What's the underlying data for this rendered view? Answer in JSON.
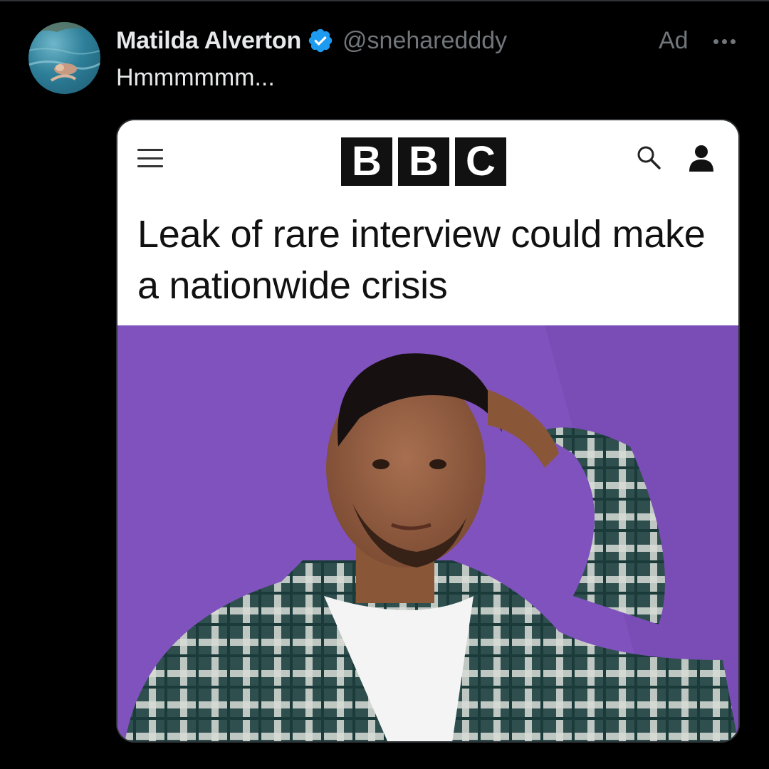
{
  "tweet": {
    "author": {
      "display_name": "Matilda Alverton",
      "handle": "@sneharedddy",
      "verified": true,
      "verified_color": "#1d9bf0"
    },
    "ad_label": "Ad",
    "more_icon": "more-horizontal-icon",
    "text": "Hmmmmmm..."
  },
  "media": {
    "bbc": {
      "logo_letters": [
        "B",
        "B",
        "C"
      ],
      "menu_icon": "hamburger-menu-icon",
      "search_icon": "search-icon",
      "account_icon": "user-account-icon",
      "headline": "Leak of rare interview could make a nationwide crisis"
    },
    "photo_background": "#8155be"
  },
  "colors": {
    "background": "#000000",
    "primary_text": "#e7e9ea",
    "secondary_text": "#71767b"
  }
}
